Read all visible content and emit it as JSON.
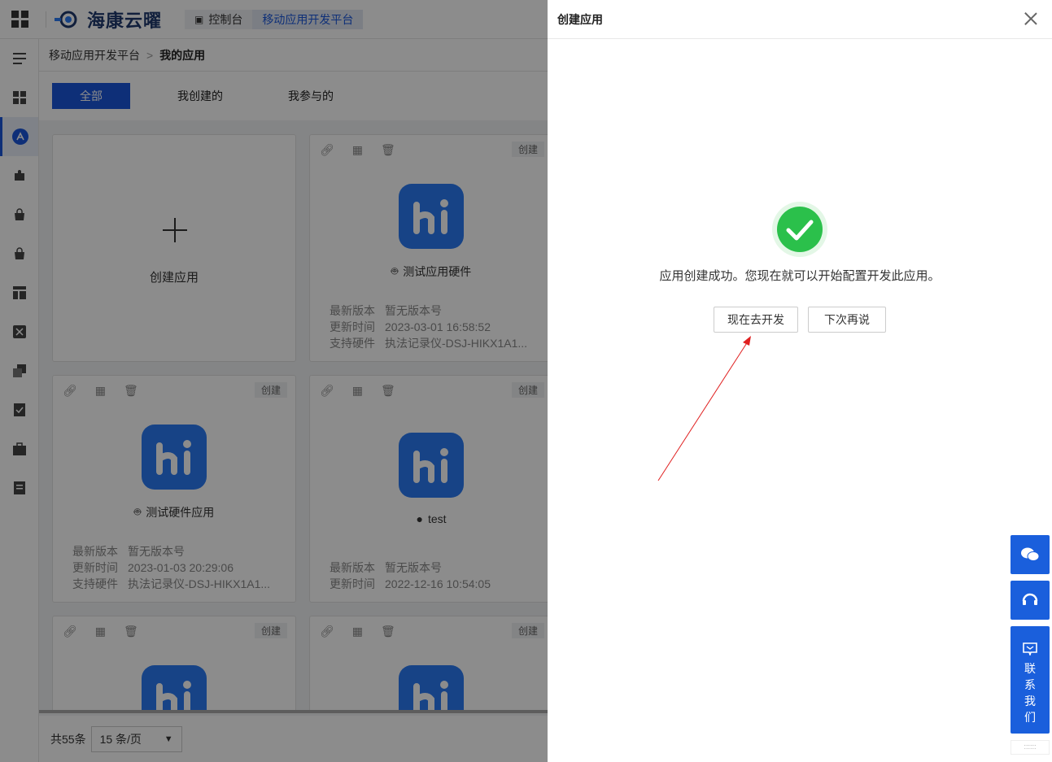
{
  "topbar": {
    "brand": "海康云曜",
    "crumbs": [
      "控制台",
      "移动应用开发平台"
    ]
  },
  "breadcrumb": {
    "parent": "移动应用开发平台",
    "separator": ">",
    "current": "我的应用"
  },
  "filters": [
    "全部",
    "我创建的",
    "我参与的"
  ],
  "create_card": {
    "label": "创建应用"
  },
  "card_tag": "创建",
  "cards": [
    {
      "name": "测试应用硬件",
      "platform": "android",
      "version_label": "最新版本",
      "version": "暂无版本号",
      "time_label": "更新时间",
      "time": "2023-03-01 16:58:52",
      "hw_label": "支持硬件",
      "hw": "执法记录仪-DSJ-HIKX1A1..."
    },
    {
      "name": "测试硬件应用",
      "platform": "android",
      "version_label": "最新版本",
      "version": "暂无版本号",
      "time_label": "更新时间",
      "time": "2023-01-03 20:29:06",
      "hw_label": "支持硬件",
      "hw": "执法记录仪-DSJ-HIKX1A1..."
    },
    {
      "name": "test",
      "platform": "ios",
      "version_label": "最新版本",
      "version": "暂无版本号",
      "time_label": "更新时间",
      "time": "2022-12-16 10:54:05"
    }
  ],
  "pager": {
    "total": "共55条",
    "page_size": "15 条/页"
  },
  "drawer": {
    "title": "创建应用",
    "message": "应用创建成功。您现在就可以开始配置开发此应用。",
    "primary_button": "现在去开发",
    "secondary_button": "下次再说"
  },
  "float": {
    "contact": [
      "联",
      "系",
      "我",
      "们"
    ],
    "handle": "::::::"
  },
  "colors": {
    "accent": "#1a56db",
    "success": "#2bc04b",
    "annotation_arrow": "#e02020"
  }
}
